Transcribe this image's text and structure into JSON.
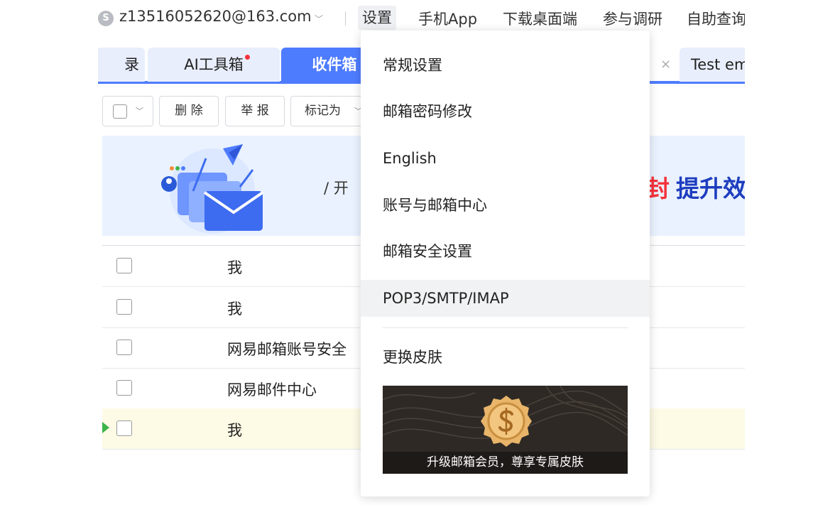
{
  "topbar": {
    "account_email": "z13516052620@163.com",
    "nav": [
      "设置",
      "手机App",
      "下载桌面端",
      "参与调研",
      "自助查询"
    ]
  },
  "tabs": {
    "items": [
      "录",
      "AI工具箱",
      "收件箱",
      "Test em"
    ]
  },
  "toolbar": {
    "delete_label": "删 除",
    "report_label": "举 报",
    "mark_label": "标记为"
  },
  "banner": {
    "small_text": "/ 开",
    "red_text": "封",
    "blue_text": "提升效"
  },
  "mail_list": {
    "rows": [
      {
        "sender": "我"
      },
      {
        "sender": "我"
      },
      {
        "sender": "网易邮箱账号安全"
      },
      {
        "sender": "网易邮件中心"
      },
      {
        "sender": "我"
      }
    ]
  },
  "settings_menu": {
    "items": [
      "常规设置",
      "邮箱密码修改",
      "English",
      "账号与邮箱中心",
      "邮箱安全设置",
      "POP3/SMTP/IMAP",
      "更换皮肤"
    ],
    "hovered_item": "POP3/SMTP/IMAP",
    "promo_text": "升级邮箱会员，尊享专属皮肤"
  },
  "colors": {
    "accent": "#4e7cff",
    "tab_inactive": "#e8eefc",
    "badge_red": "#f5323c",
    "highlight_row": "#fdfbe6"
  }
}
